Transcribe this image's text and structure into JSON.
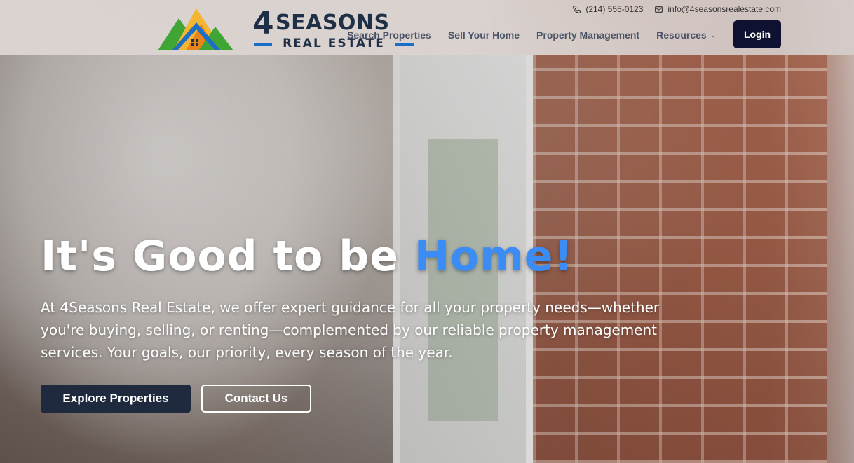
{
  "brand": {
    "number": "4",
    "word": "SEASONS",
    "tagline": "REAL ESTATE"
  },
  "contact": {
    "phone": "(214) 555-0123",
    "email": "info@4seasonsrealestate.com"
  },
  "nav": {
    "items": [
      {
        "label": "Search Properties"
      },
      {
        "label": "Sell Your Home"
      },
      {
        "label": "Property Management"
      },
      {
        "label": "Resources"
      }
    ],
    "login_label": "Login"
  },
  "hero": {
    "headline_main": "It's Good to be ",
    "headline_accent": "Home!",
    "subtext": "At 4Seasons Real Estate, we offer expert guidance for all your property needs—whether you're buying, selling, or renting—complemented by our reliable property management services. Your goals, our priority, every season of the year.",
    "primary_cta": "Explore Properties",
    "secondary_cta": "Contact Us"
  },
  "colors": {
    "accent": "#3b8cf5",
    "navy": "#0e1230",
    "button_dark": "#1f2a3e"
  }
}
